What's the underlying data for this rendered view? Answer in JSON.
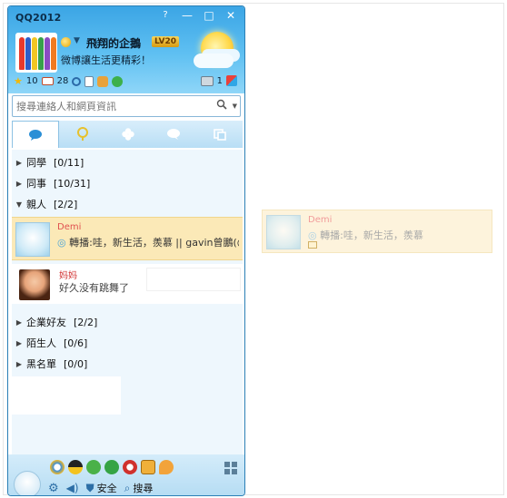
{
  "window": {
    "title": "QQ2012",
    "controls": {
      "help": "?",
      "minimize": "—",
      "maximize": "□",
      "close": "✕"
    }
  },
  "profile": {
    "nickname": "飛翔的企鵝",
    "level": "LV20",
    "signature": "微博讓生活更精彩！",
    "counters": {
      "stars": "10",
      "mail": "28",
      "messages": "1"
    }
  },
  "search": {
    "placeholder": "搜尋連絡人和網頁資訊"
  },
  "tabs": [
    {
      "name": "contacts",
      "icon": "chat-bubble-icon"
    },
    {
      "name": "weibo",
      "icon": "pin-icon"
    },
    {
      "name": "groups",
      "icon": "clover-icon"
    },
    {
      "name": "discussions",
      "icon": "speech-icon"
    },
    {
      "name": "recent",
      "icon": "recent-icon"
    }
  ],
  "groups": [
    {
      "name": "同學",
      "count": "[0/11]",
      "expanded": false
    },
    {
      "name": "同事",
      "count": "[10/31]",
      "expanded": false
    },
    {
      "name": "親人",
      "count": "[2/2]",
      "expanded": true
    },
    {
      "name": "企業好友",
      "count": "[2/2]",
      "expanded": false
    },
    {
      "name": "陌生人",
      "count": "[0/6]",
      "expanded": false
    },
    {
      "name": "黑名單",
      "count": "[0/0]",
      "expanded": false
    }
  ],
  "contacts": [
    {
      "name": "Demi",
      "status": "轉播:哇，新生活，羨慕 || gavin曾鵬(@",
      "selected": true
    },
    {
      "name": "妈妈",
      "status": "好久没有跳舞了",
      "selected": false
    }
  ],
  "drag_preview": {
    "name": "Demi",
    "status": "轉播:哇，新生活，羨慕"
  },
  "footer": {
    "security_label": "安全",
    "search_label": "搜尋"
  },
  "colors": {
    "header_top": "#3ba5e5",
    "header_bottom": "#8fd6f8",
    "selected_row": "#fbe9b7",
    "list_bg": "#eef7fd",
    "contact_name": "#e05050"
  }
}
